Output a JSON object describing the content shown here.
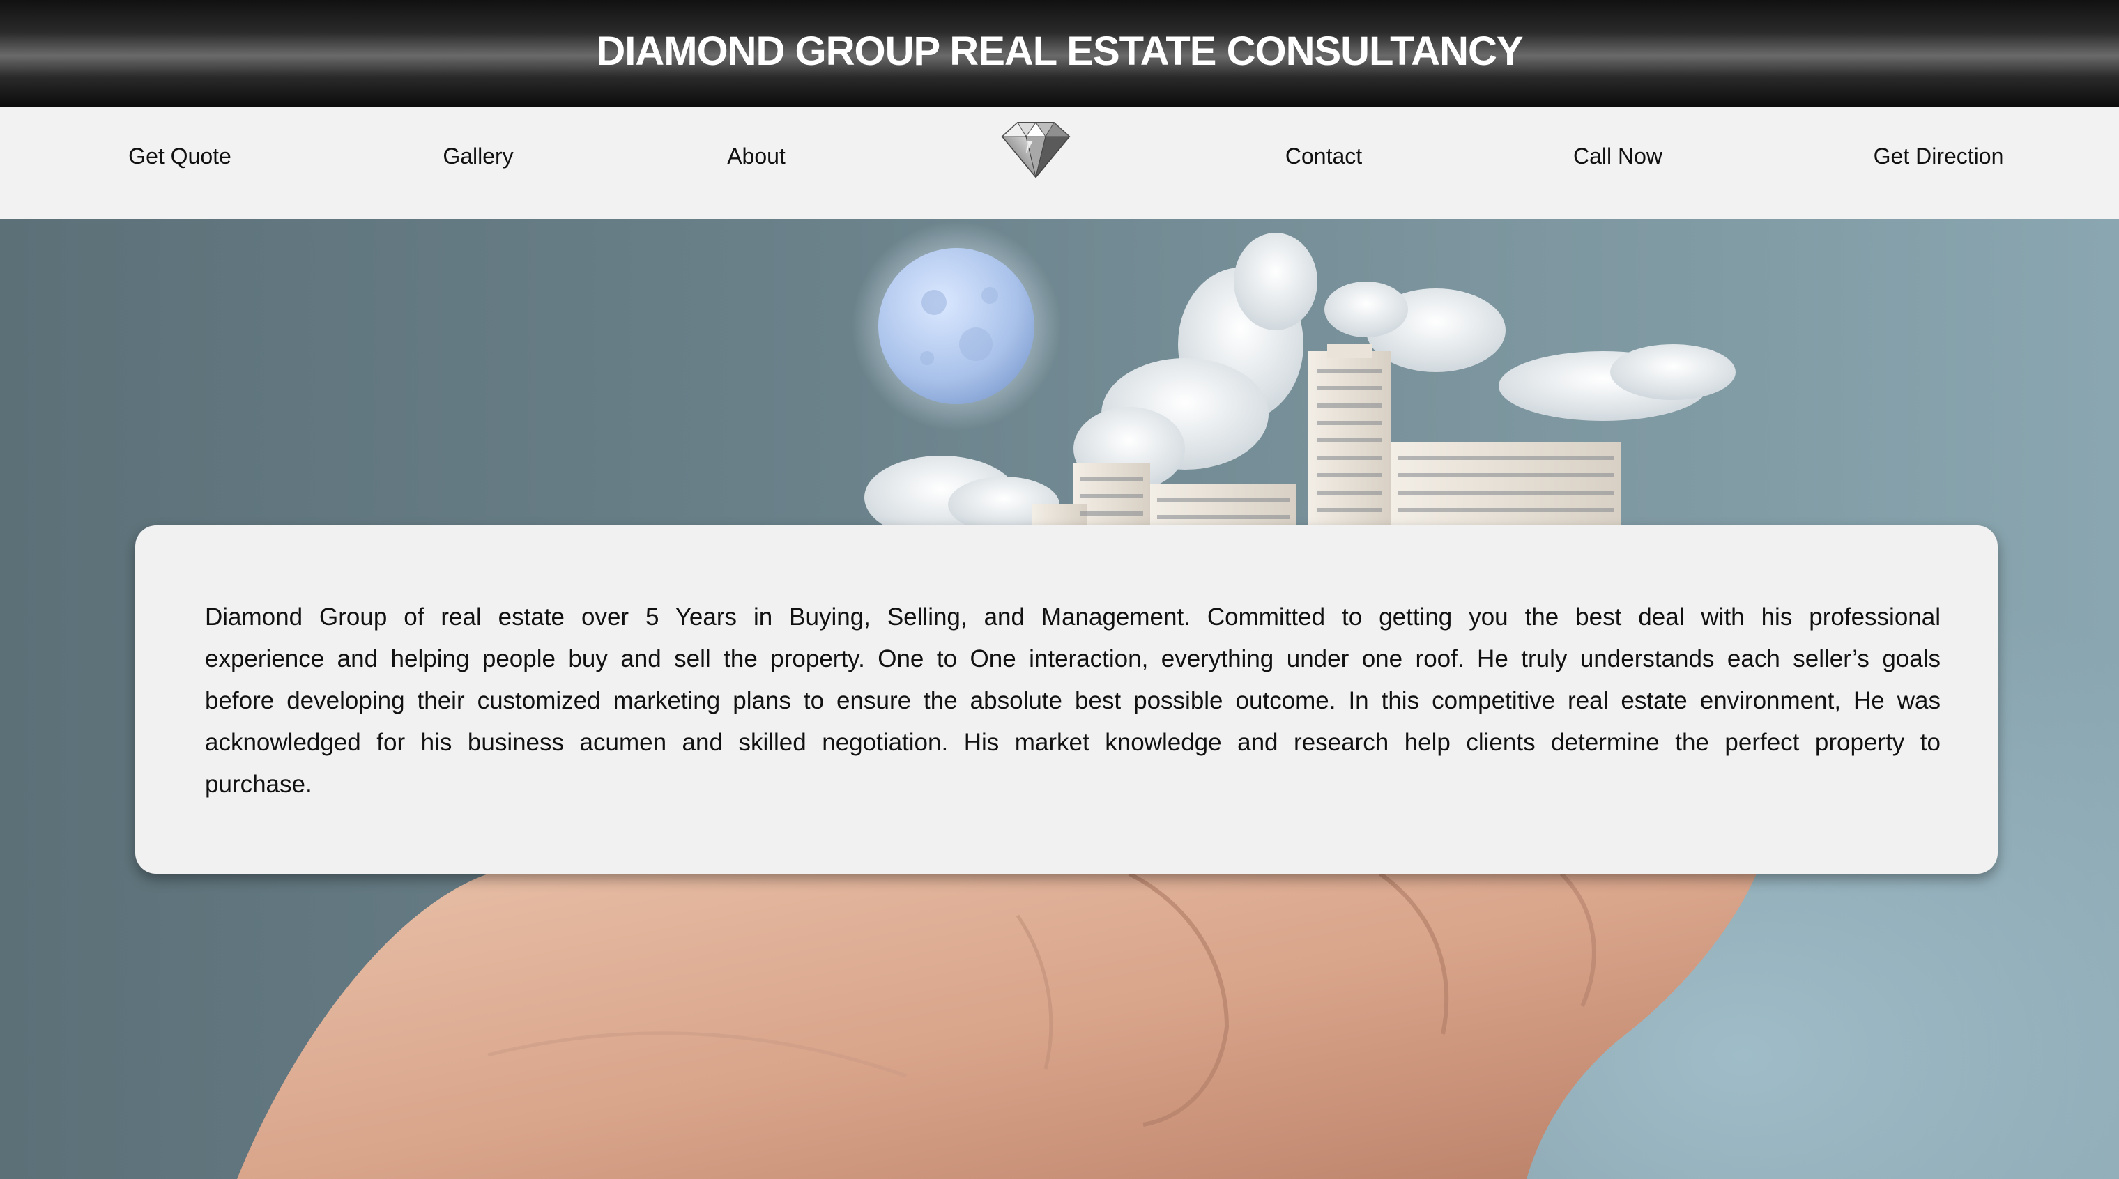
{
  "header": {
    "title": "DIAMOND GROUP REAL ESTATE CONSULTANCY"
  },
  "nav": {
    "items": [
      {
        "label": "Get Quote"
      },
      {
        "label": "Gallery"
      },
      {
        "label": "About"
      },
      {
        "label": "Contact"
      },
      {
        "label": "Call Now"
      },
      {
        "label": "Get Direction"
      }
    ],
    "logo_icon": "diamond-icon"
  },
  "hero": {
    "image": "hand-holding-buildings-under-moon"
  },
  "info": {
    "text": "Diamond Group of real estate over 5 Years in Buying, Selling, and Management. Committed to getting you the best deal with his professional experience and helping people buy and sell the property. One to One interaction, everything under one roof. He truly understands each seller’s goals before developing their customized marketing plans to ensure the absolute best possible outcome. In this competitive real estate environment, He was acknowledged for his business acumen and skilled negotiation. His market knowledge and research help clients determine the perfect property to purchase."
  },
  "colors": {
    "banner_text": "#ffffff",
    "nav_background": "#f2f2f2",
    "card_background": "#f1f1f1"
  }
}
